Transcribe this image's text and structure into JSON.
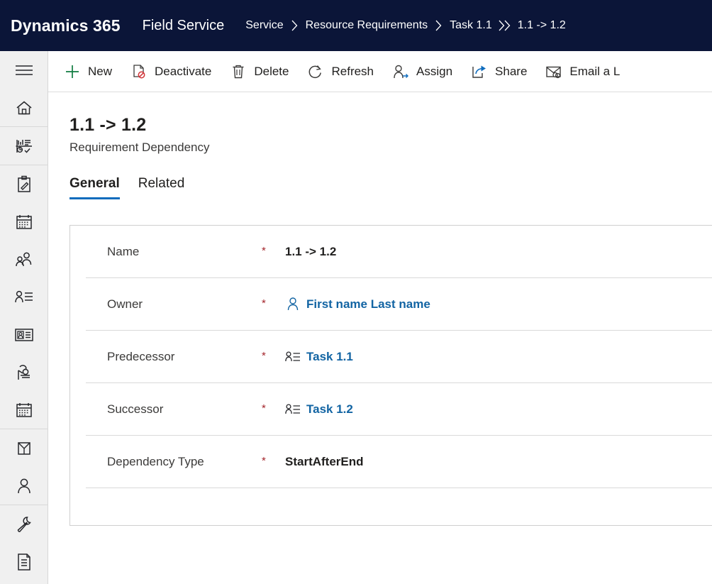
{
  "topbar": {
    "brand": "Dynamics 365",
    "app_name": "Field Service",
    "bg_color": "#0b1538",
    "breadcrumb": [
      {
        "label": "Service",
        "current": false
      },
      {
        "label": "Resource Requirements",
        "current": false
      },
      {
        "label": "Task 1.1",
        "current": false
      },
      {
        "label": "1.1 -> 1.2",
        "current": true
      }
    ]
  },
  "sidebar": {
    "items": [
      {
        "icon": "hamburger-menu-icon",
        "name": "site-map-toggle"
      },
      {
        "icon": "home-icon",
        "name": "home"
      },
      {
        "icon": "recent-charts-icon",
        "name": "recent"
      },
      {
        "icon": "clipboard-edit-icon",
        "name": "work-orders"
      },
      {
        "icon": "calendar-icon",
        "name": "schedule-board"
      },
      {
        "icon": "people-icon",
        "name": "accounts"
      },
      {
        "icon": "contact-list-icon",
        "name": "contacts"
      },
      {
        "icon": "id-card-icon",
        "name": "resources"
      },
      {
        "icon": "field-technician-icon",
        "name": "field-service"
      },
      {
        "icon": "calendar-icon",
        "name": "bookings"
      },
      {
        "icon": "archive-folder-icon",
        "name": "agreements"
      },
      {
        "icon": "person-icon",
        "name": "customers"
      },
      {
        "icon": "wrench-icon",
        "name": "settings"
      },
      {
        "icon": "document-list-icon",
        "name": "reports"
      }
    ]
  },
  "command_bar": {
    "commands": [
      {
        "label": "New",
        "icon": "plus-icon",
        "accent": "#107c41"
      },
      {
        "label": "Deactivate",
        "icon": "deactivate-icon",
        "accent": "#d13438"
      },
      {
        "label": "Delete",
        "icon": "trash-icon",
        "accent": "#201f1e"
      },
      {
        "label": "Refresh",
        "icon": "refresh-icon",
        "accent": "#201f1e"
      },
      {
        "label": "Assign",
        "icon": "assign-person-icon",
        "accent": "#0f6cbd"
      },
      {
        "label": "Share",
        "icon": "share-icon",
        "accent": "#0f6cbd"
      },
      {
        "label": "Email a L",
        "icon": "email-link-icon",
        "accent": "#0f6cbd"
      }
    ]
  },
  "record": {
    "title": "1.1 -> 1.2",
    "subtitle": "Requirement Dependency"
  },
  "tabs": [
    {
      "label": "General",
      "active": true
    },
    {
      "label": "Related",
      "active": false
    }
  ],
  "form": {
    "fields": [
      {
        "label": "Name",
        "required": "*",
        "value": "1.1 -> 1.2",
        "value_style": "plain",
        "icon": null
      },
      {
        "label": "Owner",
        "required": "*",
        "value": "First name Last name",
        "value_style": "link",
        "icon": "person-outline-icon"
      },
      {
        "label": "Predecessor",
        "required": "*",
        "value": "Task 1.1",
        "value_style": "link",
        "icon": "requirement-lookup-icon"
      },
      {
        "label": "Successor",
        "required": "*",
        "value": "Task 1.2",
        "value_style": "link",
        "icon": "requirement-lookup-icon"
      },
      {
        "label": "Dependency Type",
        "required": "*",
        "value": "StartAfterEnd",
        "value_style": "plain",
        "icon": null
      }
    ]
  },
  "colors": {
    "nav_bg": "#0b1538",
    "link": "#1264a3",
    "accent": "#0f6cbd",
    "required": "#a4262c",
    "rail_bg": "#f0f0f0"
  }
}
